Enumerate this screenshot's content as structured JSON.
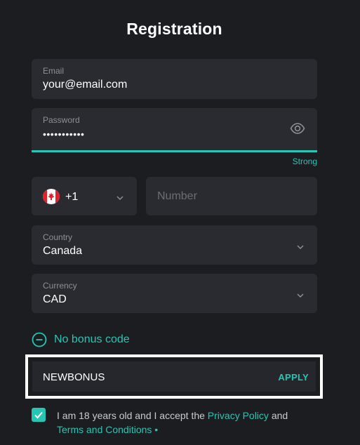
{
  "form": {
    "title": "Registration",
    "email": {
      "label": "Email",
      "value": "your@email.com"
    },
    "password": {
      "label": "Password",
      "value": "•••••••••••",
      "strength": "Strong",
      "icon": "eye-icon"
    },
    "phone": {
      "flag": "canada-flag-icon",
      "dial_code": "+1",
      "number_placeholder": "Number",
      "icon": "chevron-down-icon"
    },
    "country": {
      "label": "Country",
      "value": "Canada"
    },
    "currency": {
      "label": "Currency",
      "value": "CAD"
    },
    "bonus": {
      "toggle_label": "No bonus code",
      "code_value": "NEWBONUS",
      "apply_label": "APPLY"
    },
    "consent": {
      "checked": true,
      "text_before": "I am 18 years old and I accept the ",
      "privacy_link": "Privacy Policy",
      "text_middle": " and ",
      "terms_link": "Terms and Conditions",
      "required_mark": " •"
    }
  },
  "colors": {
    "background": "#1c1d21",
    "field": "#2a2b31",
    "accent": "#26c6b4"
  }
}
